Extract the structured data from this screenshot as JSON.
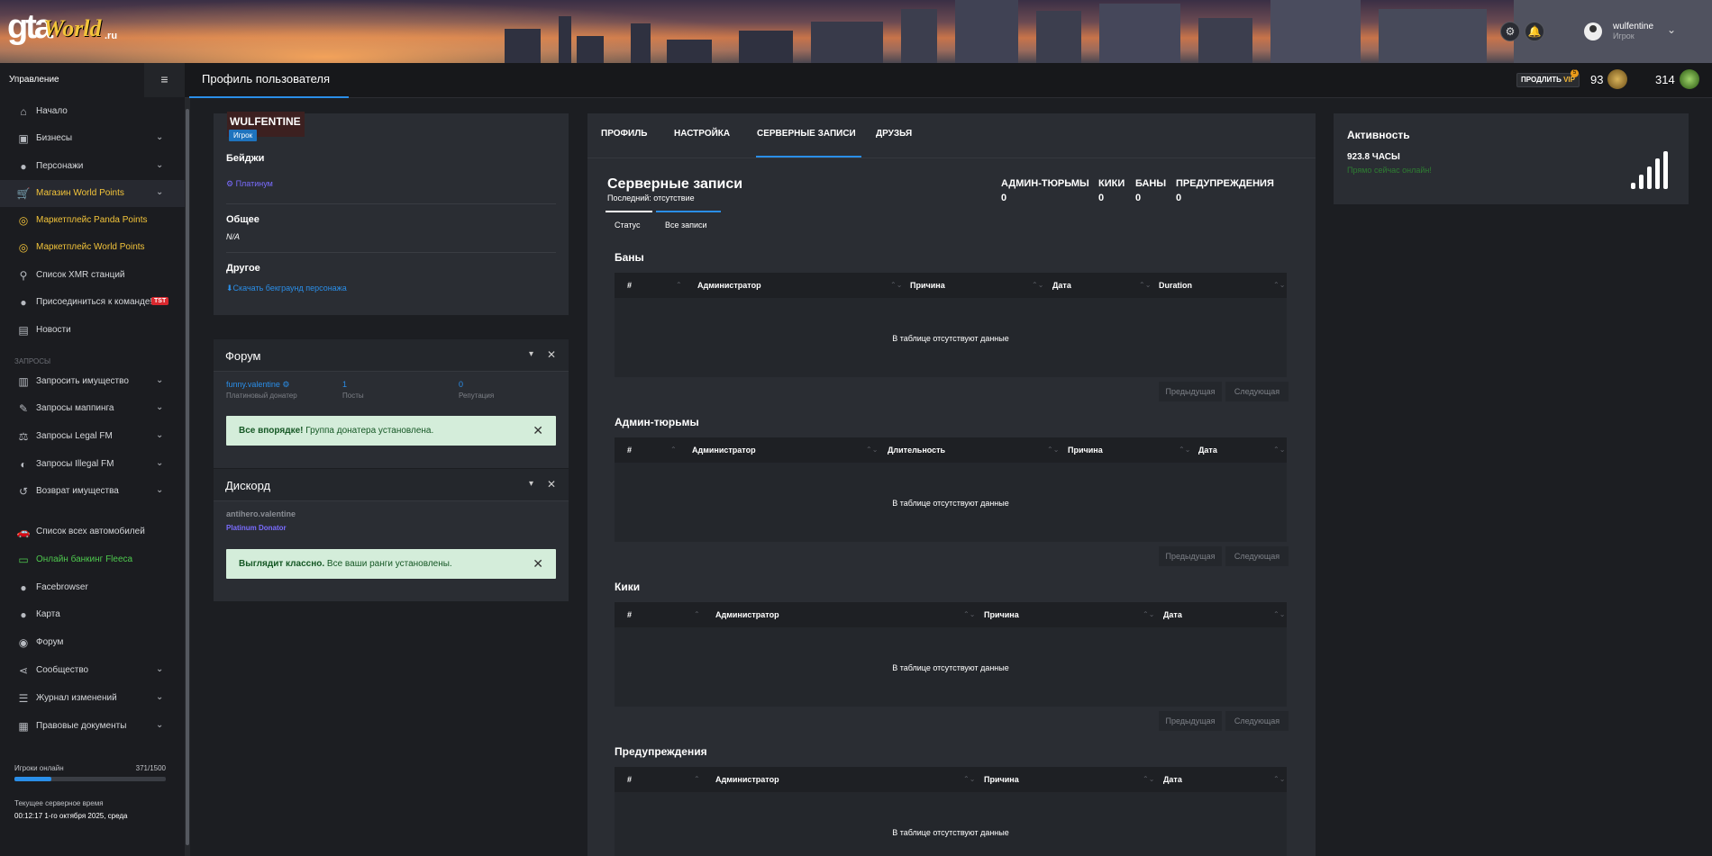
{
  "header": {
    "username": "wulfentine",
    "role": "Игрок"
  },
  "topbar": {
    "management": "Управление",
    "page_title": "Профиль пользователя",
    "vip_prefix": "ПРОДЛИТЬ",
    "vip_label": "VIP",
    "vip_badge": "5",
    "points_1": "93",
    "points_2": "314"
  },
  "sidebar": {
    "items": [
      "Начало",
      "Бизнесы",
      "Персонажи",
      "Магазин World Points",
      "Маркетплейс Panda Points",
      "Маркетплейс World Points",
      "Список XMR станций",
      "Присоединиться к команде!",
      "Новости"
    ],
    "tst": "TST",
    "section": "ЗАПРОСЫ",
    "items2": [
      "Запросить имущество",
      "Запросы маппинга",
      "Запросы Legal FM",
      "Запросы Illegal FM",
      "Возврат имущества"
    ],
    "items3": [
      "Список всех автомобилей",
      "Онлайн банкинг Fleeca",
      "Facebrowser",
      "Карта",
      "Форум",
      "Сообщество",
      "Журнал изменений",
      "Правовые документы"
    ],
    "online_label": "Игроки онлайн",
    "online_value": "371/1500",
    "online_fraction": 0.247,
    "time_label": "Текущее серверное время",
    "time_value": "00:12:17 1-го октября 2025, среда"
  },
  "profile": {
    "name": "WULFENTINE",
    "role": "Игрок",
    "badges_h": "Бейджи",
    "badge": "Платинум",
    "general_h": "Общее",
    "general_v": "N/A",
    "other_h": "Другое",
    "other_v": "Скачать бекграунд персонажа"
  },
  "forum": {
    "title": "Форум",
    "user": "funny.valentine",
    "user_sub": "Платиновый донатер",
    "posts": "1",
    "posts_l": "Посты",
    "rep": "0",
    "rep_l": "Репутация",
    "alert_b": "Все впорядке!",
    "alert_t": "Группа донатера установлена."
  },
  "discord": {
    "title": "Дискорд",
    "user": "antihero.valentine",
    "role": "Platinum Donator",
    "alert_b": "Выглядит классно.",
    "alert_t": "Все ваши ранги установлены."
  },
  "main": {
    "tabs": [
      "ПРОФИЛЬ",
      "НАСТРОЙКА",
      "СЕРВЕРНЫЕ ЗАПИСИ",
      "ДРУЗЬЯ"
    ],
    "title": "Серверные записи",
    "last": "Последний: отсутствие",
    "stats": [
      {
        "l": "АДМИН-ТЮРЬМЫ",
        "v": "0"
      },
      {
        "l": "КИКИ",
        "v": "0"
      },
      {
        "l": "БАНЫ",
        "v": "0"
      },
      {
        "l": "ПРЕДУПРЕЖДЕНИЯ",
        "v": "0"
      }
    ],
    "subtabs": [
      "Статус",
      "Все записи"
    ],
    "empty": "В таблице отсутствуют данные",
    "prev": "Предыдущая",
    "next": "Следующая",
    "bans": {
      "title": "Баны",
      "cols": [
        "#",
        "Администратор",
        "Причина",
        "Дата",
        "Duration"
      ]
    },
    "jails": {
      "title": "Админ-тюрьмы",
      "cols": [
        "#",
        "Администратор",
        "Длительность",
        "Причина",
        "Дата"
      ]
    },
    "kicks": {
      "title": "Кики",
      "cols": [
        "#",
        "Администратор",
        "Причина",
        "Дата"
      ]
    },
    "warns": {
      "title": "Предупреждения",
      "cols": [
        "#",
        "Администратор",
        "Причина",
        "Дата"
      ]
    }
  },
  "activity": {
    "title": "Активность",
    "hours": "923.8 ЧАСЫ",
    "online": "Прямо сейчас онлайн!"
  },
  "colors": {
    "accent": "#2a8ee8",
    "gold": "#f3c43a",
    "green": "#4ec94e"
  }
}
